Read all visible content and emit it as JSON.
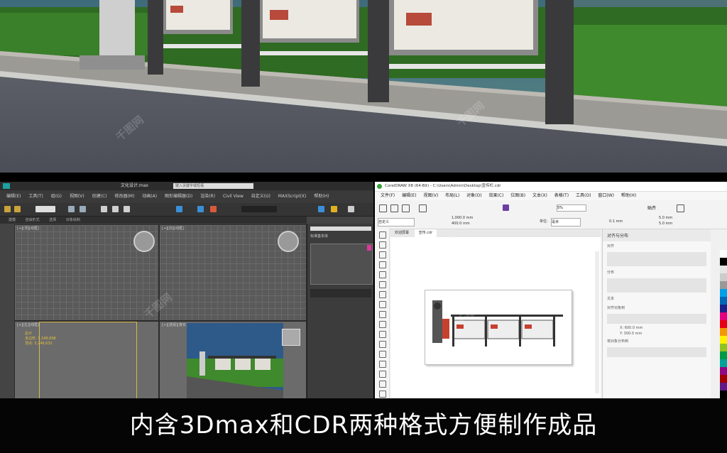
{
  "max_window": {
    "title": "文化设计.max",
    "search_placeholder": "键入关键字或短语",
    "menu": [
      "编辑(E)",
      "工具(T)",
      "组(G)",
      "视图(V)",
      "创建(C)",
      "修改器(M)",
      "动画(A)",
      "图形编辑器(D)",
      "渲染(R)",
      "Civil View",
      "自定义(U)",
      "MAXScript(X)",
      "帮助(H)"
    ],
    "ribbon_tabs": [
      "建模",
      "自由形式",
      "选择",
      "对象绘制"
    ],
    "viewports": [
      "[+][顶][线框]",
      "[+][前][线框]",
      "[+][左][线框]",
      "[+][透视][真实]"
    ],
    "vp_info": [
      "总计",
      "多边形: 1,168,898",
      "顶点: 3,246,632"
    ],
    "cmd_label": "标准基本体"
  },
  "cdr_window": {
    "title": "CorelDRAW X8 (64-Bit) - C:\\Users\\Admin\\Desktop\\宣传栏.cdr",
    "menu": [
      "文件(F)",
      "编辑(E)",
      "视图(V)",
      "布局(L)",
      "对象(O)",
      "效果(C)",
      "位图(B)",
      "文本(X)",
      "表格(T)",
      "工具(O)",
      "窗口(W)",
      "帮助(H)"
    ],
    "zoom": "5%",
    "snap": "贴齐",
    "page_preset": "自定义",
    "size_w": "1,000.0 mm",
    "size_h": "400.0 mm",
    "units": "毫米",
    "nudge": "0.1 mm",
    "dup_x": "5.0 mm",
    "dup_y": "5.0 mm",
    "unit_label": "单位:",
    "tabs": [
      "欢迎屏幕",
      "宣传.cdr"
    ],
    "docker_title": "对齐与分布",
    "docker_sections": [
      "对齐",
      "分布",
      "文本",
      "对齐对象到",
      "将对象分布到"
    ],
    "docker_x": "X: 600.0 mm",
    "docker_y": "Y: 300.0 mm",
    "palette": [
      "#ffffff",
      "#000000",
      "#e5e5e5",
      "#cccccc",
      "#999999",
      "#00a0e9",
      "#0068b7",
      "#1d2088",
      "#e4007f",
      "#e60012",
      "#f39800",
      "#fff100",
      "#8fc31f",
      "#009944",
      "#00a29a",
      "#920783",
      "#a40000",
      "#601986",
      "#000000"
    ]
  },
  "caption": "内含3Dmax和CDR两种格式方便制作成品",
  "watermark": "千图网"
}
